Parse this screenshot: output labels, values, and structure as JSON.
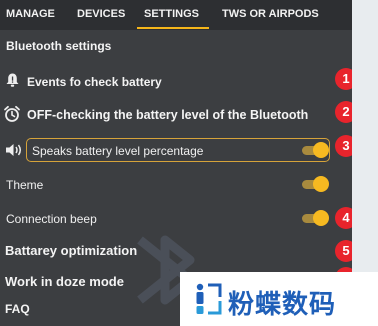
{
  "tabs": [
    {
      "label": "MANAGE"
    },
    {
      "label": "DEVICES"
    },
    {
      "label": "SETTINGS"
    },
    {
      "label": "TWS OR AIRPODS"
    }
  ],
  "active_tab": "SETTINGS",
  "settings": {
    "section_title": "Bluetooth settings",
    "rows": [
      {
        "label": "Events fo check battery",
        "icon": "bell-icon",
        "badge": "1"
      },
      {
        "label": "OFF-checking the battery level of the Bluetooth",
        "icon": "alarm-clock-icon",
        "badge": "2"
      },
      {
        "label": "Speaks battery level percentage",
        "icon": "speaker-icon",
        "badge": "3",
        "toggle_on": true
      },
      {
        "label": "Theme",
        "toggle_on": true
      },
      {
        "label": "Connection beep",
        "badge": "4",
        "toggle_on": true
      },
      {
        "label": "Battarey optimization",
        "badge": "5"
      },
      {
        "label": "Work in doze mode",
        "badge": "6"
      },
      {
        "label": "FAQ"
      }
    ]
  },
  "watermark": {
    "text": "粉蝶数码"
  },
  "colors": {
    "background": "#3c3e41",
    "tab_bar": "#2d2f32",
    "accent": "#f6b921",
    "badge": "#e8242c",
    "watermark_text": "#1f5fb8"
  }
}
